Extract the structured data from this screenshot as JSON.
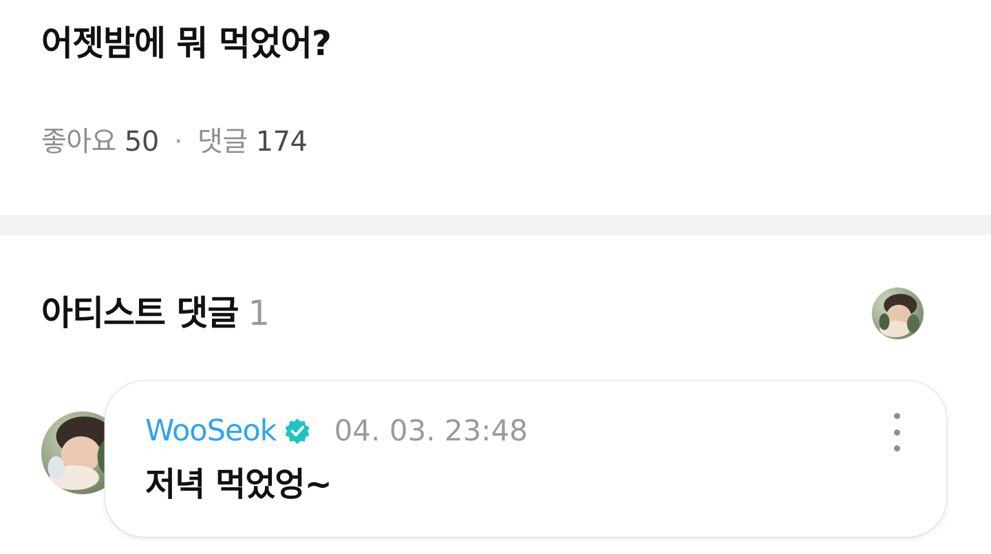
{
  "post": {
    "title": "어젯밤에 뭐 먹었어?",
    "likes_label": "좋아요",
    "likes_count": "50",
    "separator": "·",
    "comments_label": "댓글",
    "comments_count": "174"
  },
  "artist_comments": {
    "title": "아티스트 댓글",
    "count": "1",
    "header_avatar_icon": "artist-avatar-icon"
  },
  "comment": {
    "author": "WooSeok",
    "verified_icon": "verified-badge-icon",
    "timestamp": "04. 03. 23:48",
    "text": "저녁 먹었엉~",
    "more_icon": "more-vertical-icon"
  },
  "colors": {
    "author": "#2ea3f2",
    "verified": "#1ec3c3",
    "divider": "#f3f3f3",
    "muted": "#8e8e8e"
  }
}
